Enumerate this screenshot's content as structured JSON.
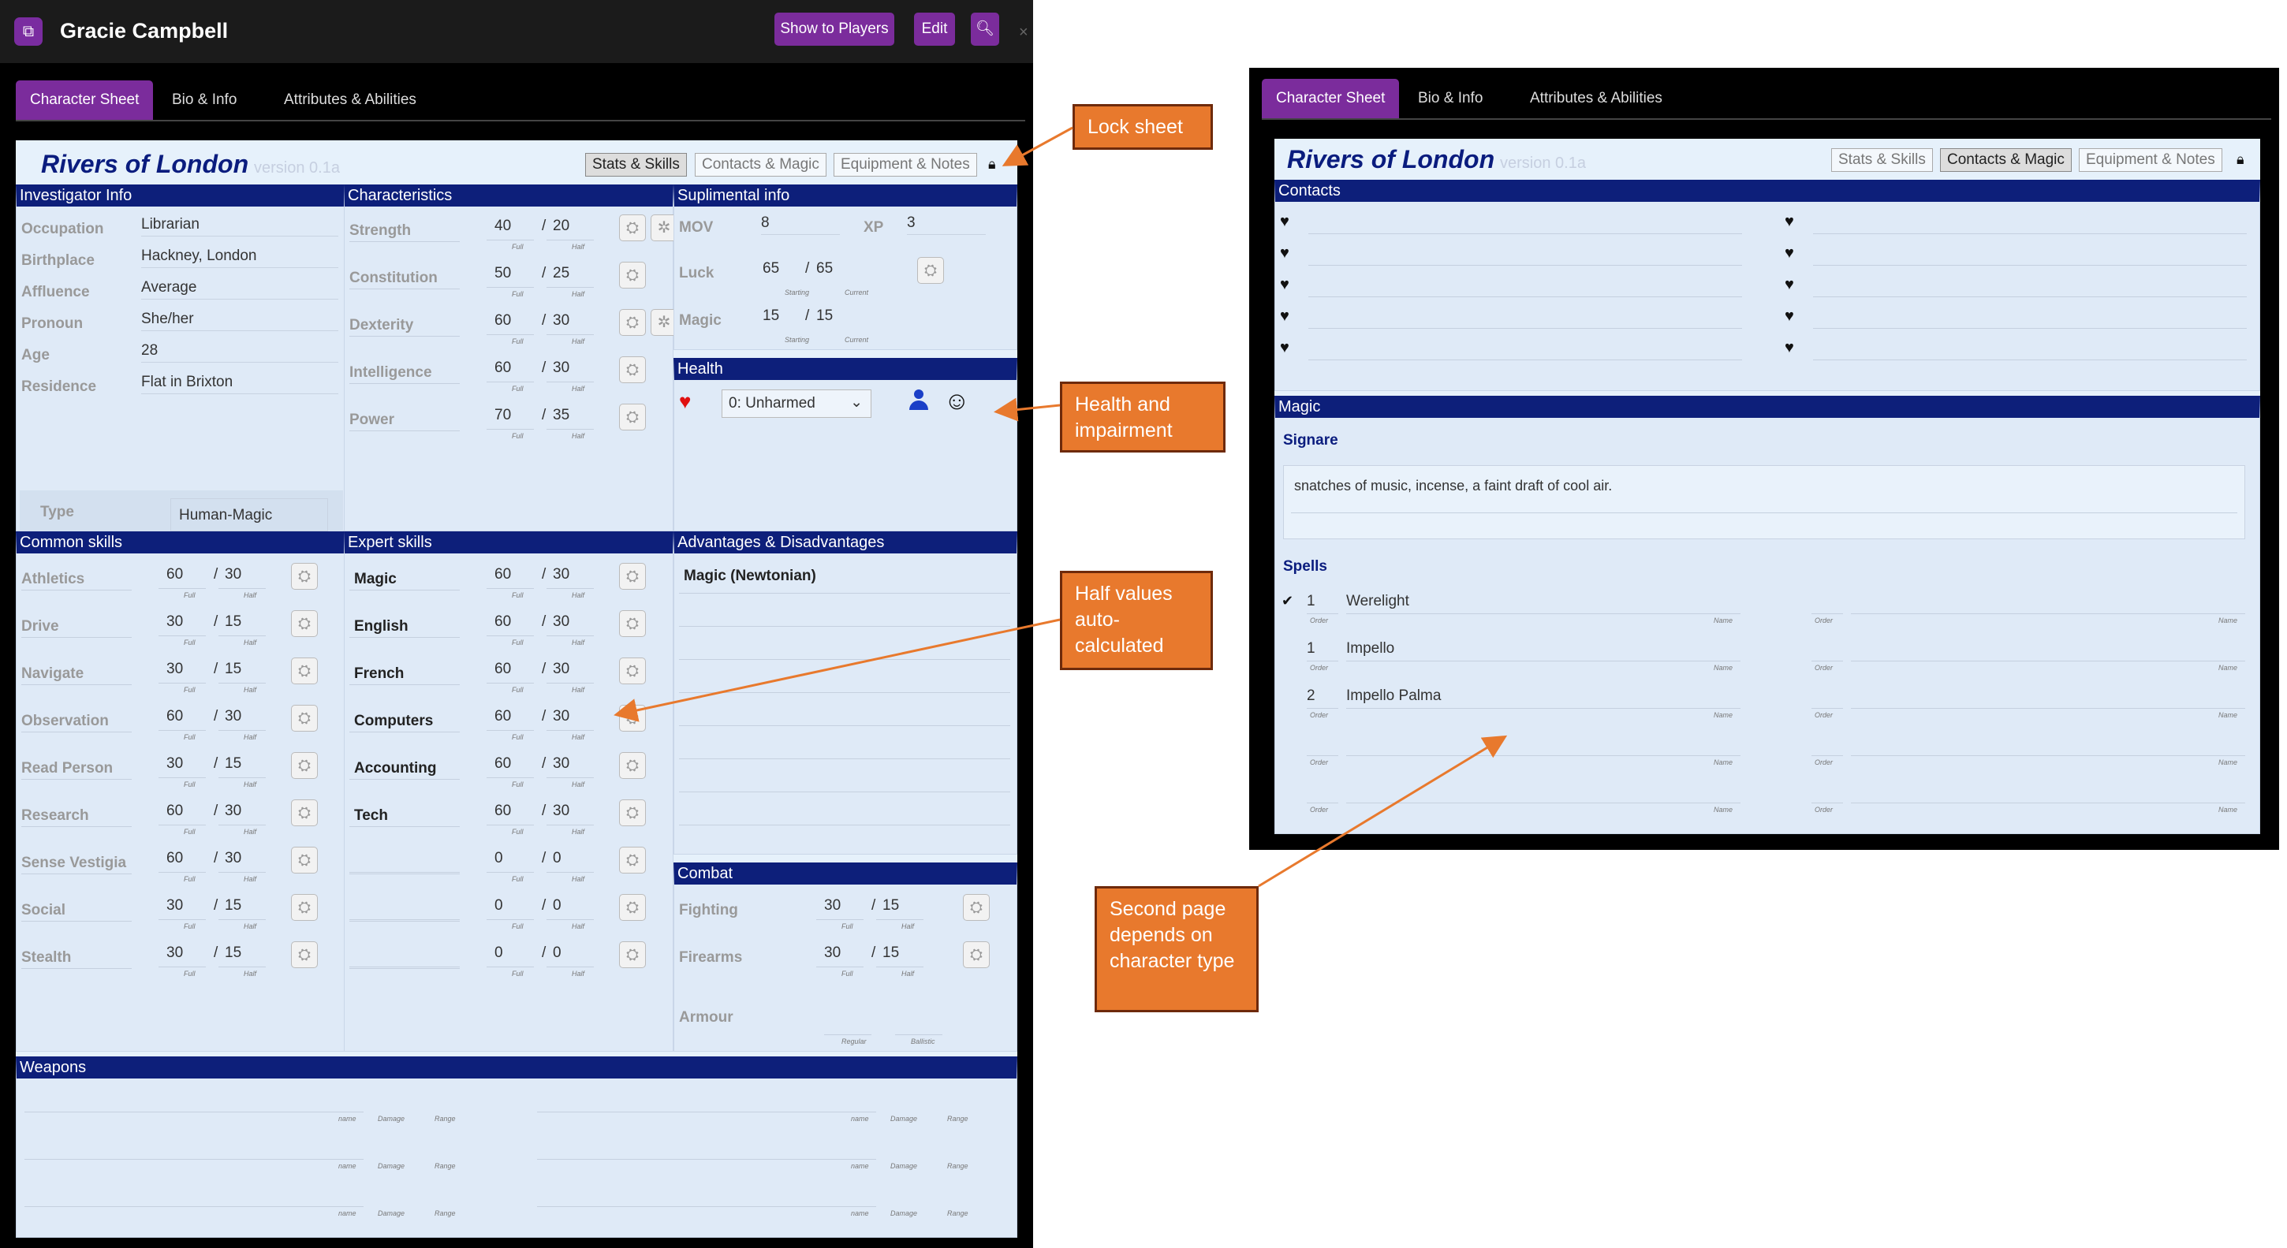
{
  "window": {
    "title": "Gracie Campbell",
    "app_icon": "roll20-icon",
    "buttons": {
      "show_to_players": "Show to Players",
      "edit": "Edit"
    },
    "tabs": [
      "Character Sheet",
      "Bio & Info",
      "Attributes & Abilities"
    ]
  },
  "sheet": {
    "title": "Rivers of London",
    "version": "version 0.1a",
    "subtabs": [
      "Stats & Skills",
      "Contacts & Magic",
      "Equipment & Notes"
    ],
    "lock_icon": "lock-icon"
  },
  "investigator": {
    "header": "Investigator Info",
    "rows": [
      {
        "label": "Occupation",
        "value": "Librarian"
      },
      {
        "label": "Birthplace",
        "value": "Hackney, London"
      },
      {
        "label": "Affluence",
        "value": "Average"
      },
      {
        "label": "Pronoun",
        "value": "She/her"
      },
      {
        "label": "Age",
        "value": "28"
      },
      {
        "label": "Residence",
        "value": "Flat in Brixton"
      }
    ],
    "type_label": "Type",
    "type_value": "Human-Magic"
  },
  "characteristics": {
    "header": "Characteristics",
    "sub_full": "Full",
    "sub_half": "Half",
    "rows": [
      {
        "label": "Strength",
        "full": "40",
        "half": "20"
      },
      {
        "label": "Constitution",
        "full": "50",
        "half": "25"
      },
      {
        "label": "Dexterity",
        "full": "60",
        "half": "30"
      },
      {
        "label": "Intelligence",
        "full": "60",
        "half": "30"
      },
      {
        "label": "Power",
        "full": "70",
        "half": "35"
      }
    ]
  },
  "supplemental": {
    "header": "Suplimental info",
    "mov_label": "MOV",
    "mov": "8",
    "xp_label": "XP",
    "xp": "3",
    "luck_label": "Luck",
    "luck_start": "65",
    "luck_current": "65",
    "magic_label": "Magic",
    "magic_start": "15",
    "magic_current": "15",
    "sub_starting": "Starting",
    "sub_current": "Current"
  },
  "health": {
    "header": "Health",
    "value": "0: Unharmed",
    "heart_color": "#e01010",
    "person_color": "#1a3fc7"
  },
  "common_skills": {
    "header": "Common skills",
    "rows": [
      {
        "label": "Athletics",
        "full": "60",
        "half": "30"
      },
      {
        "label": "Drive",
        "full": "30",
        "half": "15"
      },
      {
        "label": "Navigate",
        "full": "30",
        "half": "15"
      },
      {
        "label": "Observation",
        "full": "60",
        "half": "30"
      },
      {
        "label": "Read Person",
        "full": "30",
        "half": "15"
      },
      {
        "label": "Research",
        "full": "60",
        "half": "30"
      },
      {
        "label": "Sense Vestigia",
        "full": "60",
        "half": "30"
      },
      {
        "label": "Social",
        "full": "30",
        "half": "15"
      },
      {
        "label": "Stealth",
        "full": "30",
        "half": "15"
      }
    ]
  },
  "expert_skills": {
    "header": "Expert skills",
    "rows": [
      {
        "label": "Magic",
        "full": "60",
        "half": "30"
      },
      {
        "label": "English",
        "full": "60",
        "half": "30"
      },
      {
        "label": "French",
        "full": "60",
        "half": "30"
      },
      {
        "label": "Computers",
        "full": "60",
        "half": "30"
      },
      {
        "label": "Accounting",
        "full": "60",
        "half": "30"
      },
      {
        "label": "Tech",
        "full": "60",
        "half": "30"
      },
      {
        "label": "",
        "full": "0",
        "half": "0"
      },
      {
        "label": "",
        "full": "0",
        "half": "0"
      },
      {
        "label": "",
        "full": "0",
        "half": "0"
      }
    ]
  },
  "advantages": {
    "header": "Advantages & Disadvantages",
    "items": [
      "Magic (Newtonian)"
    ]
  },
  "combat": {
    "header": "Combat",
    "rows": [
      {
        "label": "Fighting",
        "full": "30",
        "half": "15"
      },
      {
        "label": "Firearms",
        "full": "30",
        "half": "15"
      }
    ],
    "armour_label": "Armour",
    "sub_regular": "Regular",
    "sub_ballistic": "Ballistic"
  },
  "weapons": {
    "header": "Weapons",
    "sub_name": "name",
    "sub_damage": "Damage",
    "sub_range": "Range"
  },
  "contacts": {
    "header": "Contacts"
  },
  "magic": {
    "header": "Magic",
    "signare_label": "Signare",
    "signare": "snatches of music, incense, a faint draft of cool air.",
    "spells_label": "Spells",
    "sub_order": "Order",
    "sub_name": "Name",
    "spells": [
      {
        "order": "1",
        "name": "Werelight",
        "checked": true
      },
      {
        "order": "1",
        "name": "Impello",
        "checked": false
      },
      {
        "order": "2",
        "name": "Impello Palma",
        "checked": false
      }
    ]
  },
  "callouts": {
    "lock": "Lock sheet",
    "health": "Health and impairment",
    "half": "Half values auto-calculated",
    "second": "Second page depends on character type"
  },
  "colors": {
    "accent": "#7b2c9c",
    "section_header": "#0d1f7a",
    "callout": "#e8792d"
  }
}
